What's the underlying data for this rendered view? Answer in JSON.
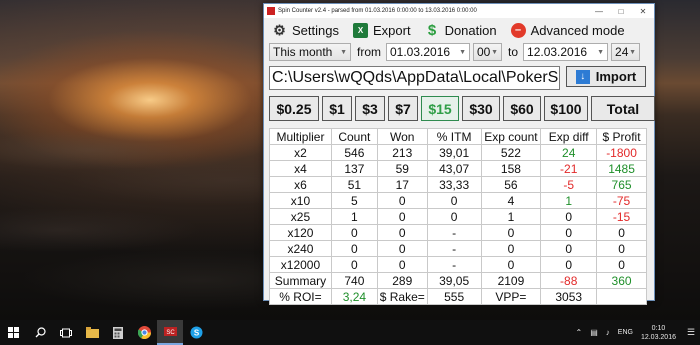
{
  "window": {
    "title": "Spin Counter v2.4 - parsed from 01.03.2016 0:00:00 to 13.03.2016 0:00:00",
    "menu": [
      {
        "label": "Settings",
        "icon": "gear-icon"
      },
      {
        "label": "Export",
        "icon": "excel-icon"
      },
      {
        "label": "Donation",
        "icon": "dollar-icon"
      },
      {
        "label": "Advanced mode",
        "icon": "minus-circle-icon"
      }
    ]
  },
  "filter": {
    "period": "This month",
    "from_label": "from",
    "from_date": "01.03.2016",
    "from_hour": "00",
    "to_label": "to",
    "to_date": "12.03.2016",
    "to_hour": "24"
  },
  "path": {
    "value": "C:\\Users\\wQQds\\AppData\\Local\\PokerS",
    "import_label": "Import"
  },
  "stakes": [
    "$0.25",
    "$1",
    "$3",
    "$7",
    "$15",
    "$30",
    "$60",
    "$100",
    "Total"
  ],
  "selected_stake": "$15",
  "table": {
    "headers": [
      "Multiplier",
      "Count",
      "Won",
      "% ITM",
      "Exp count",
      "Exp diff",
      "$ Profit"
    ],
    "rows": [
      [
        "x2",
        "546",
        "213",
        "39,01",
        "522",
        "24",
        "-1800"
      ],
      [
        "x4",
        "137",
        "59",
        "43,07",
        "158",
        "-21",
        "1485"
      ],
      [
        "x6",
        "51",
        "17",
        "33,33",
        "56",
        "-5",
        "765"
      ],
      [
        "x10",
        "5",
        "0",
        "0",
        "4",
        "1",
        "-75"
      ],
      [
        "x25",
        "1",
        "0",
        "0",
        "1",
        "0",
        "-15"
      ],
      [
        "x120",
        "0",
        "0",
        "-",
        "0",
        "0",
        "0"
      ],
      [
        "x240",
        "0",
        "0",
        "-",
        "0",
        "0",
        "0"
      ],
      [
        "x12000",
        "0",
        "0",
        "-",
        "0",
        "0",
        "0"
      ],
      [
        "Summary",
        "740",
        "289",
        "39,05",
        "2109",
        "-88",
        "360"
      ]
    ],
    "footer": {
      "roi_label": "% ROI=",
      "roi_value": "3,24",
      "rake_label": "$ Rake=",
      "rake_value": "555",
      "vpp_label": "VPP=",
      "vpp_value": "3053"
    }
  },
  "taskbar": {
    "apps": [
      "start-icon",
      "search-icon",
      "task-view-icon",
      "file-explorer-icon",
      "calculator-icon",
      "chrome-icon",
      "spin-counter-icon",
      "skype-icon"
    ],
    "language": "ENG",
    "time": "0:10",
    "date": "12.03.2016"
  },
  "colors": {
    "positive": "#1f8f2a",
    "negative": "#e22a2a",
    "selected_stake": "#2f9e47"
  }
}
